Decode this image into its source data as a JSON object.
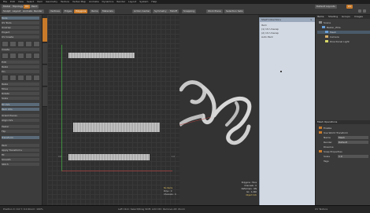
{
  "menubar": {
    "items": [
      "File",
      "Edit",
      "View",
      "Select",
      "Item",
      "Geometry",
      "Texture",
      "Vertex Map",
      "Animate",
      "Dynamics",
      "Render",
      "Layout",
      "System",
      "Help"
    ]
  },
  "toolbar": {
    "left_buttons": [
      "Model",
      "Topology",
      "UV",
      "Paint",
      "Sculpt",
      "Layout",
      "Animate",
      "Render"
    ],
    "mode_buttons": [
      "Vertices",
      "Edges",
      "Polygons",
      "Items",
      "Materials"
    ],
    "center_buttons": [
      "Action Center",
      "Symmetry",
      "Falloff",
      "Snapping"
    ],
    "right_buttons": [
      "Work Plane",
      "Selection Sets"
    ],
    "layout_label": "Default Layouts",
    "layout_badge": "UV"
  },
  "left_panel": {
    "header": "Tools",
    "section_labels": [
      "UV Tools",
      "Create",
      "Edit",
      "Relax",
      "Pack"
    ],
    "buttons": [
      "Unwrap",
      "Project",
      "UV Create",
      "Relax",
      "Pin",
      "Move",
      "Rotate",
      "Scale",
      "Fit UVs",
      "Pack UVs",
      "Orient Pieces",
      "Align UVs",
      "Peeler",
      "Flip",
      "Transform",
      "Apply Transforms",
      "Fit",
      "Smooth",
      "Stitch"
    ]
  },
  "viewport2d": {
    "corner_labels": [
      "0.0",
      "1.0"
    ],
    "info_lines": [
      "No Items",
      "Polys : 0",
      "Channels : 0"
    ]
  },
  "viewport3d": {
    "info_lines": [
      "Polygons : Face",
      "Channels : 0",
      "Deformers : ON",
      "GL : 1,440",
      "Object Info"
    ]
  },
  "dialog": {
    "title": "Shelf Collections",
    "rows": [
      "Item",
      "(1) UV Unwrap",
      "(2) UV Unwrap",
      "Auto Pack"
    ]
  },
  "right_panel": {
    "tabs": [
      "Items",
      "Shading",
      "Groups",
      "Images"
    ],
    "items": [
      {
        "name": "Scene",
        "color": "#8a8a8a"
      },
      {
        "name": "Bezier_Wire",
        "color": "#6aa0d8"
      },
      {
        "name": "Mesh",
        "color": "#6aa0d8"
      },
      {
        "name": "Camera",
        "color": "#d8b06a"
      },
      {
        "name": "Directional Light",
        "color": "#d8d86a"
      }
    ],
    "props_title": "Mesh Operations",
    "props": [
      "Enable",
      "Use World Transform",
      "Name",
      "Render",
      "Dissolve",
      "Snap Properties",
      "Scale",
      "Tags"
    ],
    "props_values": [
      "Mesh",
      "Default",
      "1.0"
    ]
  },
  "status": {
    "left": "Position X: 0.0  Y: 0.0  Zoom: 100%",
    "center": "Left Click: Select/Drag  Shift: Add  Ctrl: Remove  Alt: Zoom",
    "right": "UV Texture"
  }
}
